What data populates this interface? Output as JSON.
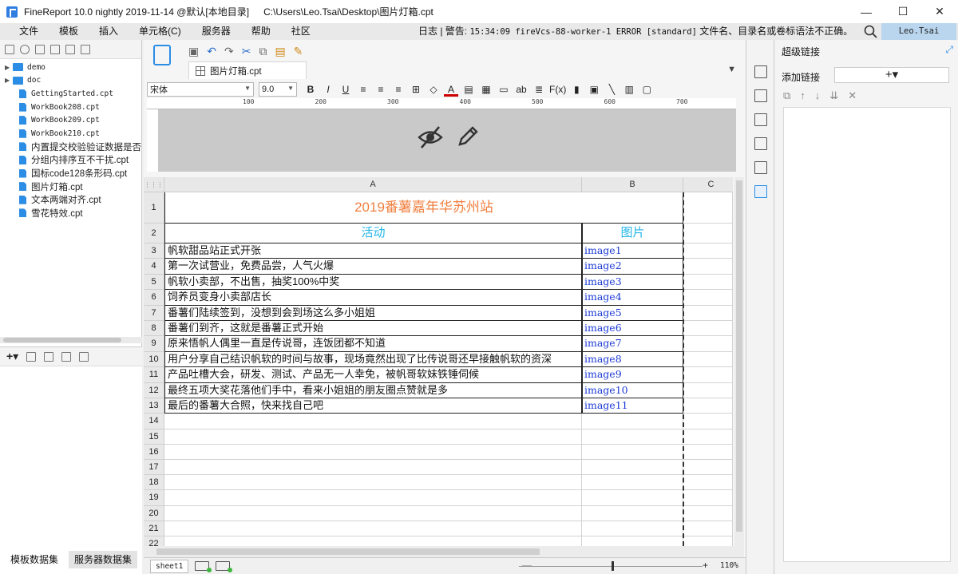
{
  "window": {
    "title": "FineReport 10.0 nightly 2019-11-14 @默认[本地目录]",
    "path": "C:\\Users\\Leo.Tsai\\Desktop\\图片灯箱.cpt",
    "minimize": "—",
    "maximize": "☐",
    "close": "✕"
  },
  "menu": {
    "items": [
      "文件",
      "模板",
      "插入",
      "单元格(C)",
      "服务器",
      "帮助",
      "社区"
    ],
    "log_prefix": "日志 | 警告:",
    "log_message": "15:34:09 fireVcs-88-worker-1 ERROR [standard]",
    "log_suffix": "文件名、目录名或卷标语法不正确。",
    "user": "Leo.Tsai"
  },
  "file_tree": {
    "folders": [
      "demo",
      "doc"
    ],
    "files": [
      {
        "name": "GettingStarted.cpt",
        "mono": true
      },
      {
        "name": "WorkBook208.cpt",
        "mono": true
      },
      {
        "name": "WorkBook209.cpt",
        "mono": true
      },
      {
        "name": "WorkBook210.cpt",
        "mono": true
      },
      {
        "name": "内置提交校验验证数据是否",
        "mono": false
      },
      {
        "name": "分组内排序互不干扰.cpt",
        "mono": false
      },
      {
        "name": "国标code128条形码.cpt",
        "mono": false
      },
      {
        "name": "图片灯箱.cpt",
        "mono": false
      },
      {
        "name": "文本两端对齐.cpt",
        "mono": false
      },
      {
        "name": "雪花特效.cpt",
        "mono": false
      }
    ]
  },
  "datasets": {
    "add": "+▾",
    "tabs": [
      "模板数据集",
      "服务器数据集"
    ]
  },
  "editor": {
    "tab_label": "图片灯箱.cpt",
    "font_name": "宋体",
    "font_size": "9.0",
    "fmt_buttons": [
      "B",
      "I",
      "U",
      "≡",
      "≡",
      "≡",
      "⊞",
      "◇",
      "A",
      "▤",
      "▦",
      "▭",
      "ab",
      "≣",
      "F(x)",
      "▮",
      "▣",
      "╲",
      "▥",
      "▢"
    ],
    "ruler_marks": [
      "100",
      "200",
      "300",
      "400",
      "500",
      "600",
      "700"
    ],
    "columns": [
      "A",
      "B",
      "C"
    ],
    "corner": "⋮⋮⋮"
  },
  "sheet": {
    "title": "2019番薯嘉年华苏州站",
    "header_activity": "活动",
    "header_image": "图片",
    "rows": [
      {
        "activity": "帆软甜品站正式开张",
        "image": "image1"
      },
      {
        "activity": "第一次试营业，免费品尝，人气火爆",
        "image": "image2"
      },
      {
        "activity": "帆软小卖部，不出售，抽奖100%中奖",
        "image": "image3"
      },
      {
        "activity": "饲养员变身小卖部店长",
        "image": "image4"
      },
      {
        "activity": "番薯们陆续签到，没想到会到场这么多小姐姐",
        "image": "image5"
      },
      {
        "activity": "番薯们到齐，这就是番薯正式开始",
        "image": "image6"
      },
      {
        "activity": "原来悟帆人偶里一直是传说哥，连饭团都不知道",
        "image": "image7"
      },
      {
        "activity": "用户分享自己结识帆软的时间与故事，现场竟然出现了比传说哥还早接触帆软的资深",
        "image": "image8"
      },
      {
        "activity": "产品吐槽大会，研发、测试、产品无一人幸免，被帆哥软妹铁锤伺候",
        "image": "image9"
      },
      {
        "activity": "最终五项大奖花落他们手中，看来小姐姐的朋友圈点赞就是多",
        "image": "image10"
      },
      {
        "activity": "最后的番薯大合照，快来找自己吧",
        "image": "image11"
      }
    ],
    "empty_rows": [
      "14",
      "15",
      "16",
      "17",
      "18",
      "19",
      "20",
      "21",
      "22"
    ]
  },
  "statusbar": {
    "sheet_name": "sheet1",
    "zoom": "110%",
    "zoom_minus": "—",
    "zoom_plus": "+"
  },
  "right_panel": {
    "title": "超级链接",
    "add_label": "添加链接",
    "add_button": "+▾",
    "tools": [
      "⧉",
      "↑",
      "↓",
      "⇊",
      "✕"
    ]
  }
}
